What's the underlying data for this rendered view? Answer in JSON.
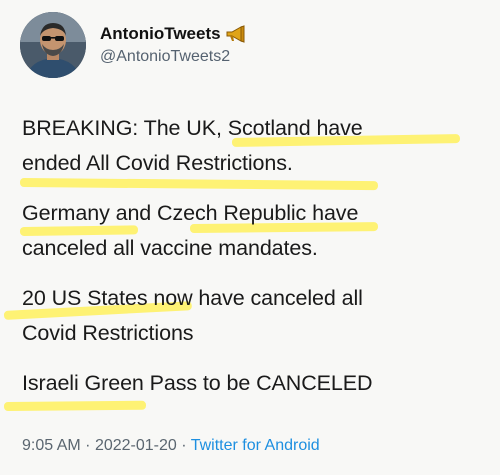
{
  "author": {
    "display_name": "AntonioTweets",
    "handle": "@AntonioTweets2",
    "badge_icon": "megaphone-icon",
    "avatar_icon": "profile-photo"
  },
  "tweet": {
    "paragraphs": [
      {
        "lines": [
          "BREAKING: The UK, Scotland have",
          "ended All Covid Restrictions."
        ]
      },
      {
        "lines": [
          "Germany and Czech Republic have",
          "canceled all vaccine mandates."
        ]
      },
      {
        "lines": [
          "20 US States now have canceled all",
          "Covid Restrictions"
        ]
      },
      {
        "lines": [
          "Israeli Green Pass to be CANCELED"
        ]
      }
    ]
  },
  "meta": {
    "time": "9:05 AM",
    "separator": "·",
    "date": "2022-01-20",
    "source": "Twitter for Android"
  },
  "colors": {
    "highlight": "#fff050",
    "link": "#1d8fe0",
    "muted": "#5b6670"
  }
}
